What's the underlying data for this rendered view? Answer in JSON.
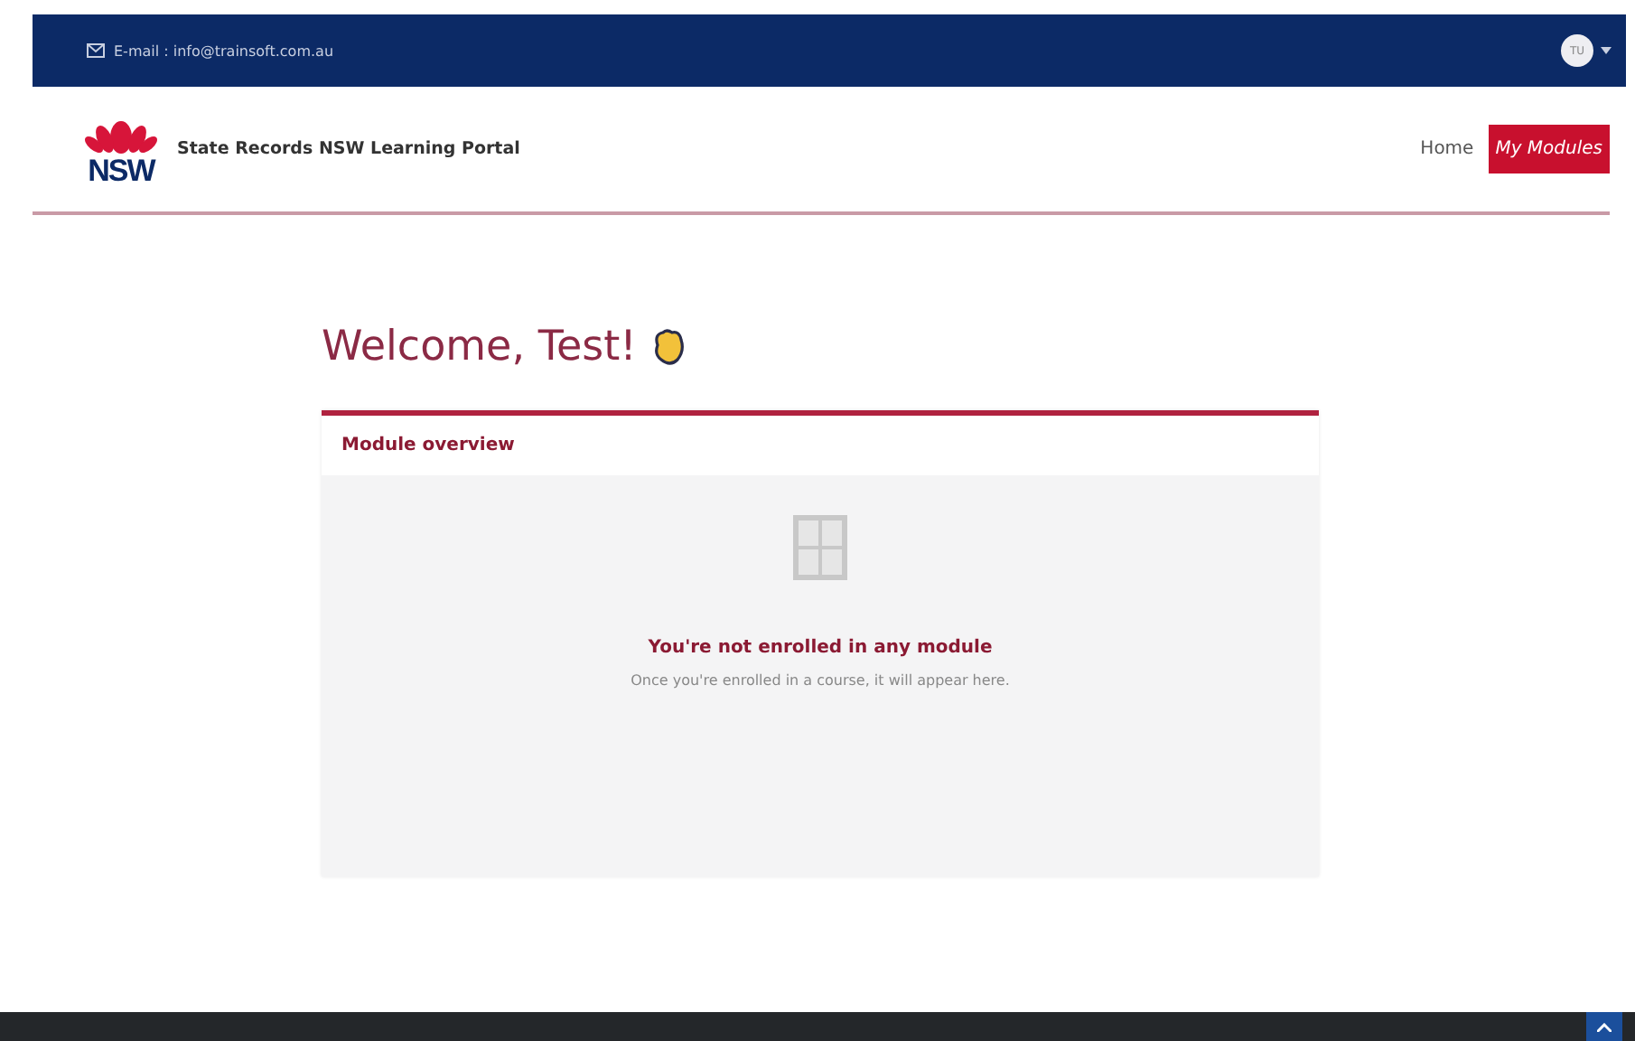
{
  "top_bar": {
    "email": "E-mail : info@trainsoft.com.au",
    "avatar_initials": "TU"
  },
  "header": {
    "logo_text": "NSW",
    "site_title": "State Records NSW Learning Portal",
    "nav": [
      {
        "label": "Home",
        "selected": false
      },
      {
        "label": "My Modules",
        "selected": true
      }
    ]
  },
  "welcome": {
    "heading": "Welcome, Test!"
  },
  "module_overview": {
    "title": "Module overview",
    "empty_title": "You're not enrolled in any module",
    "empty_text": "Once you're enrolled in a course, it will appear here."
  }
}
